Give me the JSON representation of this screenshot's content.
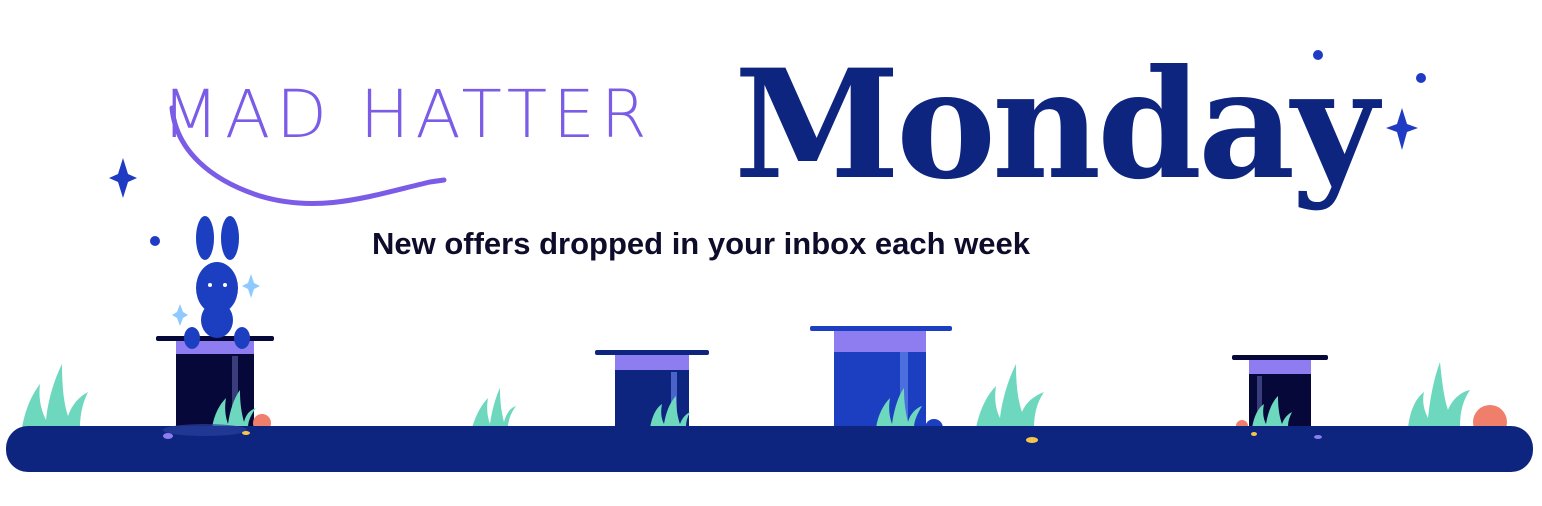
{
  "banner": {
    "script_title": "MAD HATTER",
    "serif_title": "Monday",
    "subtitle": "New offers dropped in your inbox each week"
  },
  "colors": {
    "script_purple": "#7b5ce6",
    "navy": "#0e2580",
    "sparkle_blue": "#1f3bc4",
    "grass": "#6ed8bf",
    "hat_dark": "#07083a",
    "hat_band": "#8e7cf1",
    "hat_blue": "#1c3fc1",
    "rock": "#ef7f6b"
  },
  "icons": [
    "sparkle-icon",
    "rabbit-icon",
    "top-hat-icon",
    "grass-icon",
    "pebble-icon"
  ]
}
